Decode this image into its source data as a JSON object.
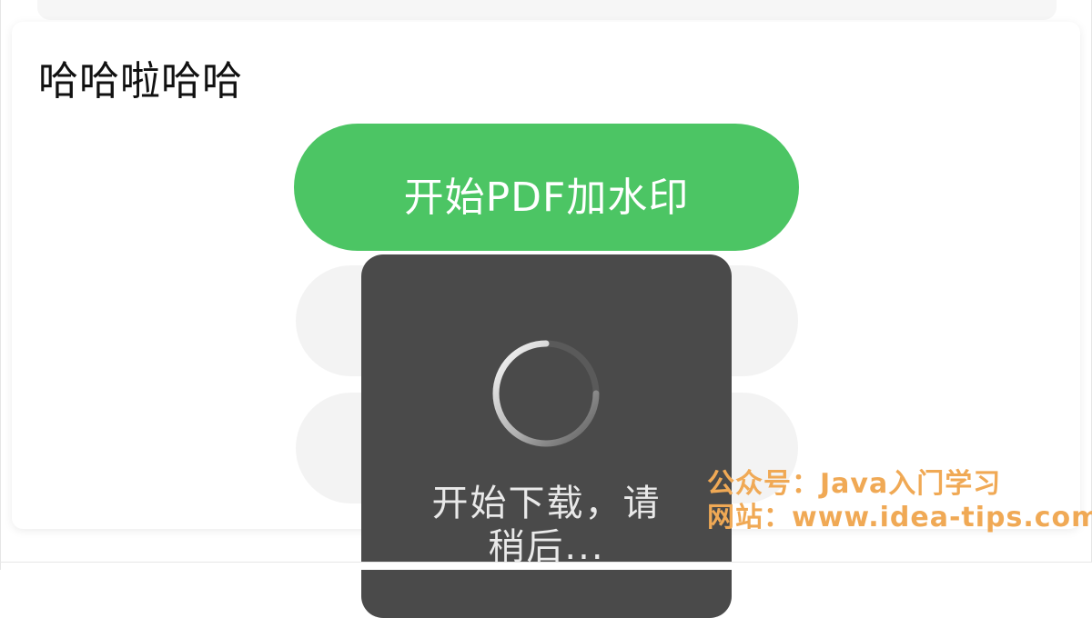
{
  "page": {
    "title": "哈哈啦哈哈"
  },
  "actions": {
    "primary_label": "开始PDF加水印"
  },
  "toast": {
    "message": "开始下载，请稍后..."
  },
  "watermark": {
    "line1": "公众号：Java入门学习",
    "line2": "网站：www.idea-tips.com"
  },
  "colors": {
    "primary": "#4cc564",
    "toast_bg": "#4a4a4a",
    "watermark": "#f0a955"
  },
  "icons": {
    "loading": "spinner-icon"
  }
}
